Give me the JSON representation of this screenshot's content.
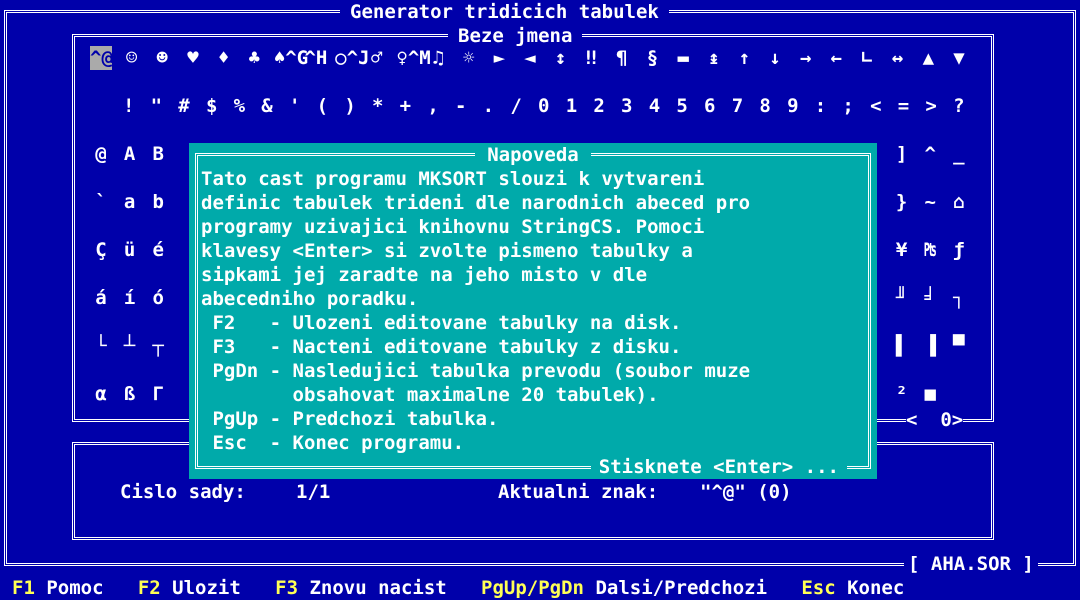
{
  "app": {
    "title": "Generator tridicich tabulek",
    "file_label": "[ AHA.SOR ]"
  },
  "charset_panel": {
    "title": "Beze jmena",
    "rows": [
      [
        "^@",
        "☺",
        "☻",
        "♥",
        "♦",
        "♣",
        "♠^G",
        "^H",
        "○^J",
        "♂",
        "♀^M",
        "♫",
        "☼",
        "►",
        "◄",
        "↕",
        "‼",
        "¶",
        "§",
        "▬",
        "↨",
        "↑",
        "↓",
        "→",
        "←",
        "∟",
        "↔",
        "▲",
        "▼"
      ],
      [
        " ",
        "!",
        "\"",
        "#",
        "$",
        "%",
        "&",
        "'",
        "(",
        ")",
        "*",
        "+",
        ",",
        "-",
        ".",
        "/",
        "0",
        "1",
        "2",
        "3",
        "4",
        "5",
        "6",
        "7",
        "8",
        "9",
        ":",
        ";",
        "<",
        "=",
        ">",
        "?"
      ],
      [
        "@",
        "A",
        "B",
        "",
        "",
        "",
        "",
        "",
        "",
        "",
        "",
        "",
        "",
        "",
        "",
        "",
        "",
        "",
        "",
        "",
        "",
        "",
        "",
        "",
        "",
        "",
        "",
        "",
        "]",
        "^",
        "_"
      ],
      [
        "`",
        "a",
        "b",
        "",
        "",
        "",
        "",
        "",
        "",
        "",
        "",
        "",
        "",
        "",
        "",
        "",
        "",
        "",
        "",
        "",
        "",
        "",
        "",
        "",
        "",
        "",
        "",
        "",
        "}",
        "~",
        "⌂"
      ],
      [
        "Ç",
        "ü",
        "é",
        "",
        "",
        "",
        "",
        "",
        "",
        "",
        "",
        "",
        "",
        "",
        "",
        "",
        "",
        "",
        "",
        "",
        "",
        "",
        "",
        "",
        "",
        "",
        "",
        "",
        "¥",
        "₧",
        "ƒ"
      ],
      [
        "á",
        "í",
        "ó",
        "",
        "",
        "",
        "",
        "",
        "",
        "",
        "",
        "",
        "",
        "",
        "",
        "",
        "",
        "",
        "",
        "",
        "",
        "",
        "",
        "",
        "",
        "",
        "",
        "",
        "╜",
        "╛",
        "┐"
      ],
      [
        "└",
        "┴",
        "┬",
        "",
        "",
        "",
        "",
        "",
        "",
        "",
        "",
        "",
        "",
        "",
        "",
        "",
        "",
        "",
        "",
        "",
        "",
        "",
        "",
        "",
        "",
        "",
        "",
        "",
        "▌",
        "▐",
        "▀"
      ],
      [
        "α",
        "ß",
        "Γ",
        "",
        "",
        "",
        "",
        "",
        "",
        "",
        "",
        "",
        "",
        "",
        "",
        "",
        "",
        "",
        "",
        "",
        "",
        "",
        "",
        "",
        "",
        "",
        "",
        "",
        "²",
        "■",
        " "
      ]
    ],
    "nav_indicator": "<  0>"
  },
  "info_panel": {
    "set_label": "Cislo sady:",
    "set_value": "1/1",
    "char_label": "Aktualni znak:",
    "char_value": "\"^@\" (0)"
  },
  "help_dialog": {
    "title": "Napoveda",
    "lines": [
      "Tato cast programu MKSORT slouzi k vytvareni",
      "definic tabulek trideni dle narodnich abeced pro",
      "programy uzivajici knihovnu StringCS. Pomoci",
      "klavesy <Enter> si zvolte pismeno tabulky a",
      "sipkami jej zaradte na jeho misto v dle",
      "abecedniho poradku.",
      " F2   - Ulozeni editovane tabulky na disk.",
      " F3   - Nacteni editovane tabulky z disku.",
      " PgDn - Nasledujici tabulka prevodu (soubor muze",
      "        obsahovat maximalne 20 tabulek).",
      " PgUp - Predchozi tabulka.",
      " Esc  - Konec programu."
    ],
    "footer": "Stisknete <Enter> ..."
  },
  "status_bar": {
    "items": [
      {
        "key": "F1",
        "label": "Pomoc"
      },
      {
        "key": "F2",
        "label": "Ulozit"
      },
      {
        "key": "F3",
        "label": "Znovu nacist"
      },
      {
        "key": "PgUp/PgDn",
        "label": "Dalsi/Predchozi"
      },
      {
        "key": "Esc",
        "label": "Konec"
      }
    ]
  },
  "colors": {
    "background": "#0000aa",
    "dialog": "#00aaaa",
    "key_highlight": "#ffff55",
    "text": "#ffffff"
  }
}
